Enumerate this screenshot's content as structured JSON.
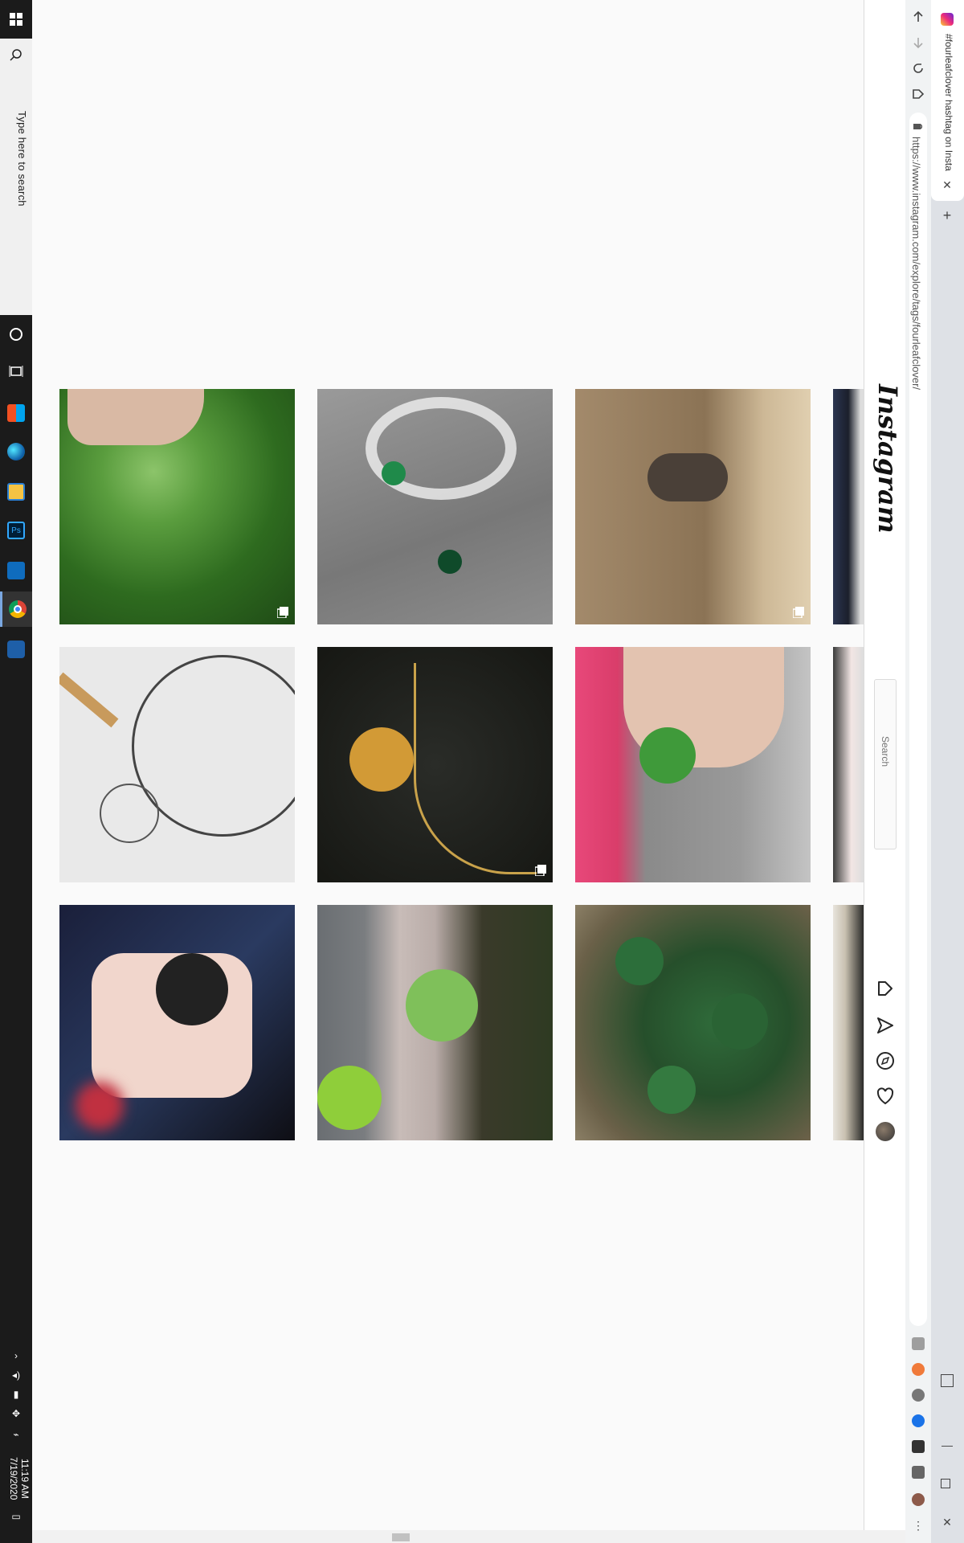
{
  "taskbar": {
    "search_placeholder": "Type here to search",
    "time": "11:19 AM",
    "date": "7/19/2020",
    "apps": [
      "cortana-icon",
      "task-view-icon",
      "microsoft-store-icon",
      "edge-icon",
      "file-explorer-icon",
      "photoshop-icon",
      "outlook-icon",
      "chrome-icon",
      "settings-icon"
    ]
  },
  "browser": {
    "tab_title": "#fourleafclover hashtag on Insta",
    "url": "https://www.instagram.com/explore/tags/fourleafclover/",
    "new_tab_label": "+"
  },
  "instagram": {
    "logo": "Instagram",
    "search_placeholder": "Search"
  },
  "grid": {
    "rows": [
      [
        {
          "subject": "hand holding clover among green plants",
          "multi": true
        },
        {
          "subject": "glass bangle with green clover charms",
          "multi": false
        },
        {
          "subject": "horse rider in dry field",
          "multi": true
        }
      ],
      [
        {
          "subject": "pencil sketch of watch with clover",
          "multi": false
        },
        {
          "subject": "gold four leaf clover pendant necklace",
          "multi": true
        },
        {
          "subject": "hand holding four leaf clover",
          "multi": false
        }
      ],
      [
        {
          "subject": "illustrated character artwork",
          "multi": false
        },
        {
          "subject": "clover growing in planter",
          "multi": false
        },
        {
          "subject": "patch of clover leaves",
          "multi": false
        }
      ]
    ]
  },
  "colors": {
    "taskbar": "#1b1b1b",
    "page_bg": "#fafafa",
    "chrome_bar": "#f1f3f4"
  }
}
